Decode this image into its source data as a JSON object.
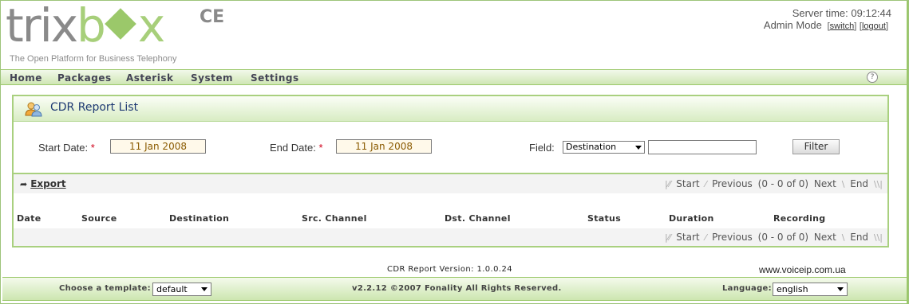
{
  "header": {
    "logo_prefix": "trix",
    "logo_mid": "b",
    "logo_suffix": "x",
    "logo_edition": "CE",
    "tagline": "The Open Platform for Business Telephony",
    "server_time_label": "Server time:",
    "server_time": "09:12:44",
    "mode_label": "Admin Mode",
    "switch_label": "switch",
    "logout_label": "logout"
  },
  "nav": {
    "items": [
      {
        "label": "Home"
      },
      {
        "label": "Packages"
      },
      {
        "label": "Asterisk"
      },
      {
        "label": "System"
      },
      {
        "label": "Settings"
      }
    ],
    "help": "?"
  },
  "panel": {
    "title": "CDR Report List",
    "icon": "users-icon"
  },
  "filter": {
    "start_label": "Start Date:",
    "start_value": "11 Jan 2008",
    "end_label": "End Date:",
    "end_value": "11 Jan 2008",
    "required_mark": "*",
    "field_label": "Field:",
    "field_selected": "Destination",
    "field_value": "",
    "filter_button": "Filter"
  },
  "results": {
    "export_label": "Export",
    "pager": {
      "start": "Start",
      "previous": "Previous",
      "range": "(0 - 0 of 0)",
      "next": "Next",
      "end": "End"
    },
    "columns": [
      "Date",
      "Source",
      "Destination",
      "Src. Channel",
      "Dst. Channel",
      "Status",
      "Duration",
      "Recording"
    ],
    "rows": []
  },
  "footer": {
    "version": "CDR Report Version: 1.0.0.24",
    "site": "www.voiceip.com.ua",
    "template_label": "Choose a template:",
    "template_selected": "default",
    "copyright": "v2.2.12 ©2007 Fonality All Rights Reserved.",
    "language_label": "Language:",
    "language_selected": "english"
  },
  "colors": {
    "accent_green": "#9bc86a",
    "title_blue": "#1f3a73",
    "required_red": "#d0021b"
  }
}
